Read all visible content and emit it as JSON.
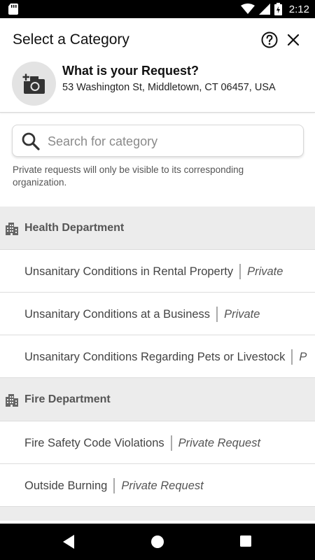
{
  "status_bar": {
    "time": "2:12",
    "icons": [
      "sd-card-icon",
      "wifi-icon",
      "signal-icon",
      "battery-icon"
    ]
  },
  "header": {
    "title": "Select a Category",
    "help_icon": "help-circle-icon",
    "close_icon": "close-icon"
  },
  "request": {
    "camera_icon": "add-photo-icon",
    "title": "What is your Request?",
    "address": "53 Washington St, Middletown, CT 06457, USA"
  },
  "search": {
    "placeholder": "Search for category",
    "value": ""
  },
  "private_note": "Private requests will only be visible to its corresponding organization.",
  "departments": [
    {
      "name": "Health Department",
      "icon": "building-icon",
      "categories": [
        {
          "label": "Unsanitary Conditions in Rental Property",
          "tag": "Private"
        },
        {
          "label": "Unsanitary Conditions at a Business",
          "tag": "Private"
        },
        {
          "label": "Unsanitary Conditions Regarding Pets or Livestock",
          "tag": "P"
        }
      ]
    },
    {
      "name": "Fire Department",
      "icon": "building-icon",
      "categories": [
        {
          "label": "Fire Safety Code Violations",
          "tag": "Private Request"
        },
        {
          "label": "Outside Burning",
          "tag": "Private Request"
        }
      ]
    }
  ],
  "nav_bar": {
    "icons": [
      "back-icon",
      "home-icon",
      "recents-icon"
    ]
  },
  "colors": {
    "status_bar": "#000000",
    "department_header": "#ececec",
    "camera_circle": "#e3e3e3"
  }
}
